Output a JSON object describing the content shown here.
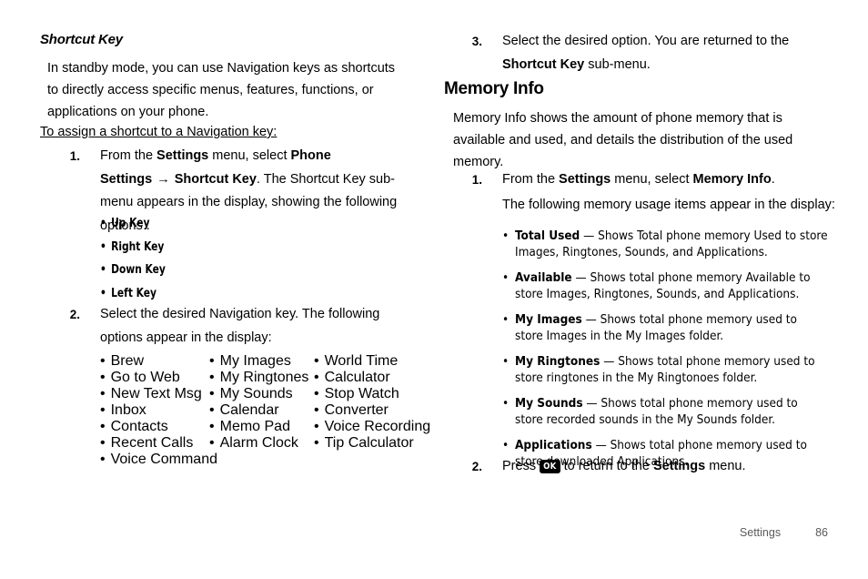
{
  "left_column": {
    "heading": "Shortcut Key",
    "intro": "In standby mode, you can use Navigation keys as shortcuts to directly access specific menus, features, functions, or applications on your phone.",
    "subheading": "To assign a shortcut to a Navigation key:",
    "step1": {
      "number": "1.",
      "text_part1": "From the ",
      "bold1": "Settings",
      "text_part2": " menu, select ",
      "bold2": "Phone Settings",
      "arrow": "→",
      "bold3": "Shortcut Key",
      "text_part3": ". The Shortcut Key sub-menu appears in the display, showing the following options :"
    },
    "step1_options": [
      "Up Key",
      "Right Key",
      "Down Key",
      "Left Key"
    ],
    "step2": {
      "number": "2.",
      "text": "Select the desired Navigation key. The following options appear in the display:"
    },
    "option_columns": [
      [
        "Brew",
        "Go to Web",
        "New Text Msg",
        "Inbox",
        "Contacts",
        "Recent Calls",
        "Voice Command"
      ],
      [
        "My Images",
        "My Ringtones",
        "My Sounds",
        "Calendar",
        "Memo Pad",
        "Alarm Clock"
      ],
      [
        "World Time",
        "Calculator",
        "Stop Watch",
        "Converter",
        "Voice Recording",
        "Tip Calculator"
      ]
    ],
    "bullet_char": "•"
  },
  "right_column": {
    "step3": {
      "number": "3.",
      "text_part1": "Select the desired option. You are returned to the ",
      "bold1": "Shortcut Key",
      "text_part2": " sub-menu."
    },
    "heading": "Memory Info",
    "intro": "Memory Info shows the amount of phone memory that is available and used, and details the distribution of the used memory.",
    "step1": {
      "number": "1.",
      "text_part1": "From the ",
      "bold1": "Settings",
      "text_part2": " menu, select ",
      "bold2": "Memory Info",
      "text_part3": "."
    },
    "substep_text": "The following memory usage items appear in the display:",
    "definitions": [
      {
        "term": "Total Used",
        "dash": "—",
        "description": "Shows Total phone memory Used to store Images, Ringtones, Sounds, and Applications."
      },
      {
        "term": "Available",
        "dash": "—",
        "description": "Shows total phone memory Available to store Images, Ringtones, Sounds, and Applications."
      },
      {
        "term": "My Images",
        "dash": "—",
        "description": "Shows total phone memory used to store Images in the My Images folder."
      },
      {
        "term": "My Ringtones",
        "dash": "—",
        "description": "Shows total phone memory used to store ringtones in the My Ringtonoes folder."
      },
      {
        "term": "My Sounds",
        "dash": "—",
        "description": "Shows total phone memory used to store recorded sounds in the My Sounds folder."
      },
      {
        "term": "Applications",
        "dash": "—",
        "description": "Shows total phone memory used to store downloaded Applications."
      }
    ],
    "step2": {
      "number": "2.",
      "text_part1": "Press ",
      "ok_key_label": "OK",
      "text_part2": " to return to the ",
      "bold1": "Settings",
      "text_part3": " menu."
    },
    "bullet_char": "•"
  },
  "footer": {
    "section_name": "Settings",
    "page_number": "86"
  }
}
